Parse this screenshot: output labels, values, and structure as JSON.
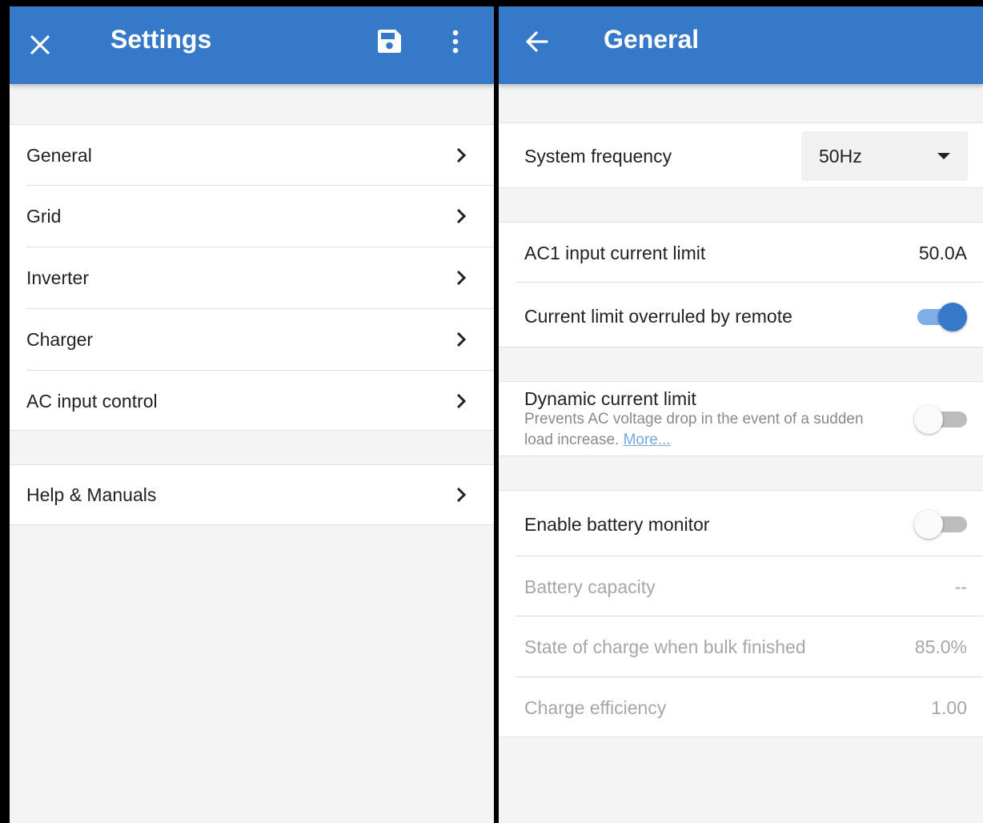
{
  "left": {
    "title": "Settings",
    "icons": {
      "close": "close-icon",
      "save": "save-icon",
      "more": "more-vert-icon"
    },
    "menu": [
      {
        "label": "General"
      },
      {
        "label": "Grid"
      },
      {
        "label": "Inverter"
      },
      {
        "label": "Charger"
      },
      {
        "label": "AC input control"
      }
    ],
    "help": {
      "label": "Help & Manuals"
    }
  },
  "right": {
    "title": "General",
    "icons": {
      "back": "arrow-back-icon"
    },
    "system_frequency": {
      "label": "System frequency",
      "value": "50Hz"
    },
    "ac1_limit": {
      "label": "AC1 input current limit",
      "value": "50.0A"
    },
    "overruled": {
      "label": "Current limit overruled by remote",
      "on": true
    },
    "dynamic": {
      "label": "Dynamic current limit",
      "desc_line1": "Prevents AC voltage drop in the event of a sudden",
      "desc_line2": "load increase.",
      "more": "More...",
      "on": false
    },
    "battery_monitor": {
      "label": "Enable battery monitor",
      "on": false
    },
    "battery_capacity": {
      "label": "Battery capacity",
      "value": "--"
    },
    "soc_bulk": {
      "label": "State of charge when bulk finished",
      "value": "85.0%"
    },
    "charge_eff": {
      "label": "Charge efficiency",
      "value": "1.00"
    }
  },
  "colors": {
    "accent": "#3679c9",
    "toggle_on_track": "#7eaee6",
    "link": "#78a9e0"
  }
}
